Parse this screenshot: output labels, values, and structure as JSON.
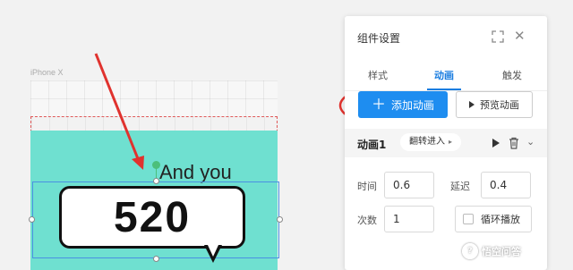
{
  "canvas": {
    "device_label": "iPhone X",
    "and_you_text": "And you",
    "bubble_text": "520"
  },
  "panel": {
    "title": "组件设置",
    "expand_icon": "expand-icon",
    "close_icon": "close-icon",
    "tabs": [
      {
        "label": "样式",
        "active": false
      },
      {
        "label": "动画",
        "active": true
      },
      {
        "label": "触发",
        "active": false
      }
    ],
    "add_animation_label": "添加动画",
    "preview_animation_label": "预览动画",
    "animation": {
      "name": "动画1",
      "effect": "翻转进入"
    },
    "fields": {
      "time_label": "时间",
      "time_value": "0.6",
      "delay_label": "延迟",
      "delay_value": "0.4",
      "count_label": "次数",
      "count_value": "1",
      "loop_label": "循环播放",
      "loop_checked": false
    }
  },
  "watermark": {
    "text": "悟空问答"
  },
  "colors": {
    "accent": "#1e8df0",
    "screen_bg": "#6fe0d0",
    "annotation_red": "#e0322e"
  }
}
